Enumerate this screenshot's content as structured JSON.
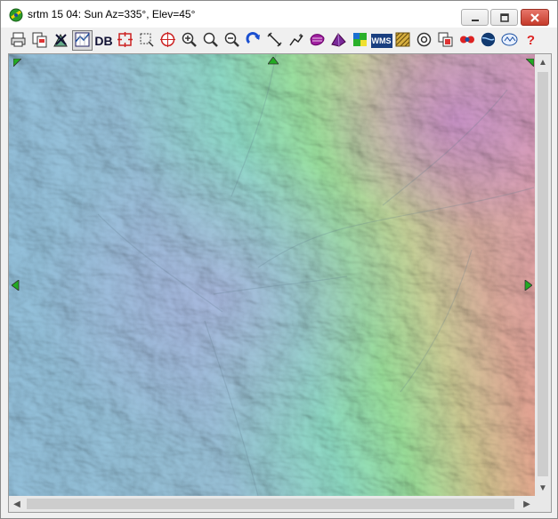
{
  "window": {
    "title": "srtm 15 04: Sun Az=335°, Elev=45°"
  },
  "toolbar": {
    "buttons": [
      {
        "name": "print-icon"
      },
      {
        "name": "copy-image-icon"
      },
      {
        "name": "map-tools-icon"
      },
      {
        "name": "map-grid-icon",
        "pressed": true
      },
      {
        "name": "database-button",
        "label": "DB"
      },
      {
        "name": "zoom-extent-icon"
      },
      {
        "name": "select-area-icon"
      },
      {
        "name": "target-icon"
      },
      {
        "name": "zoom-in-icon"
      },
      {
        "name": "zoom-full-icon"
      },
      {
        "name": "zoom-out-icon"
      },
      {
        "name": "redraw-icon"
      },
      {
        "name": "measure-distance-icon"
      },
      {
        "name": "measure-path-icon"
      },
      {
        "name": "purple-shape-icon"
      },
      {
        "name": "3d-view-icon"
      },
      {
        "name": "color-map-icon"
      },
      {
        "name": "wms-button",
        "label": "WMS"
      },
      {
        "name": "texture-icon"
      },
      {
        "name": "circle-target-icon"
      },
      {
        "name": "overlay-icon"
      },
      {
        "name": "dual-circles-icon"
      },
      {
        "name": "globe-icon"
      },
      {
        "name": "web-logo-icon"
      },
      {
        "name": "help-icon",
        "label": "?"
      }
    ]
  },
  "colors": {
    "title_bar": "#ffffff",
    "close_button": "#c53a2a",
    "marker_green": "#22aa22"
  }
}
